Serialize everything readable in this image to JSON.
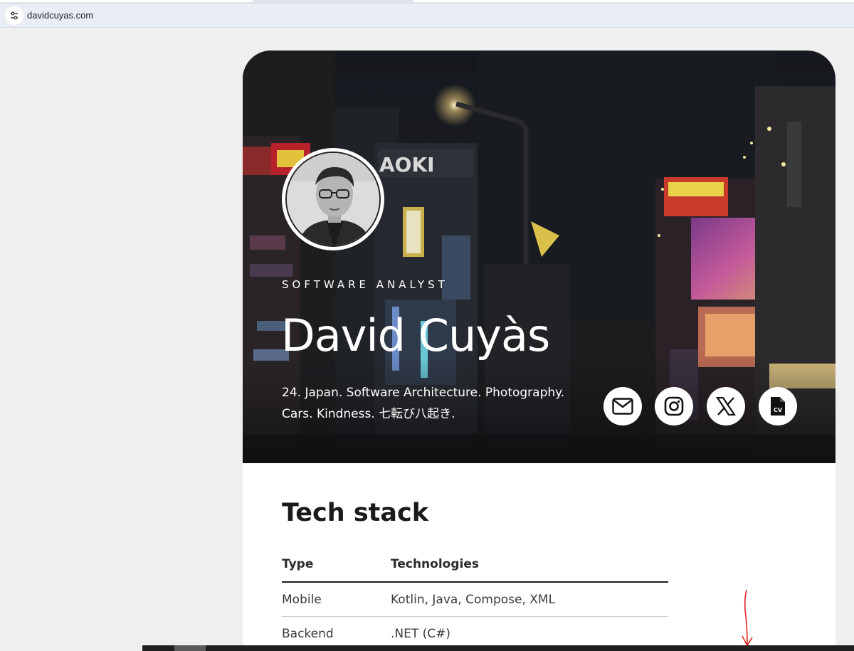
{
  "browser": {
    "url": "davidcuyas.com"
  },
  "hero": {
    "role": "SOFTWARE ANALYST",
    "name": "David Cuyàs",
    "bio_line1": "24. Japan. Software Architecture. Photography.",
    "bio_line2": "Cars. Kindness. 七転び八起き.",
    "sign_text_1": "AOKI",
    "sign_text_2": "AOKI",
    "social_buttons": [
      {
        "icon": "mail-icon"
      },
      {
        "icon": "instagram-icon"
      },
      {
        "icon": "x-icon"
      },
      {
        "icon": "cv-icon",
        "label": "CV"
      }
    ]
  },
  "tech_stack": {
    "title": "Tech stack",
    "headers": [
      "Type",
      "Technologies"
    ],
    "rows": [
      [
        "Mobile",
        "Kotlin, Java, Compose, XML"
      ],
      [
        "Backend",
        ".NET (C#)"
      ]
    ]
  },
  "colors": {
    "page_bg": "#f0efef",
    "card_bg": "#ffffff",
    "annotation": "#e02020"
  }
}
